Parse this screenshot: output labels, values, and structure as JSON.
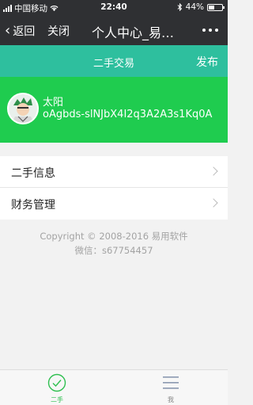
{
  "status_bar": {
    "carrier": "中国移动",
    "time": "22:40",
    "battery": "44%",
    "battery_level": 0.44,
    "icons": [
      "signal-icon",
      "wifi-icon",
      "bluetooth-icon",
      "battery-icon"
    ]
  },
  "nav": {
    "back_label": "返回",
    "close_label": "关闭",
    "title": "个人中心_易…",
    "more_icon": "more-icon"
  },
  "header": {
    "title": "二手交易",
    "publish_label": "发布",
    "color": "#2ebf9e"
  },
  "profile": {
    "name": "太阳",
    "uid": "oAgbds-slNJbX4I2q3A2A3s1Kq0A",
    "color": "#1fcc4f"
  },
  "menu": {
    "items": [
      {
        "label": "二手信息"
      },
      {
        "label": "财务管理"
      }
    ]
  },
  "footer": {
    "copyright": "Copyright © 2008-2016 易用软件",
    "wechat": "微信：s67754457"
  },
  "tabbar": {
    "tabs": [
      {
        "label": "二手",
        "icon": "check-circle-icon",
        "active": true
      },
      {
        "label": "我",
        "icon": "menu-icon",
        "active": false
      }
    ],
    "active_color": "#2ebf4f"
  }
}
